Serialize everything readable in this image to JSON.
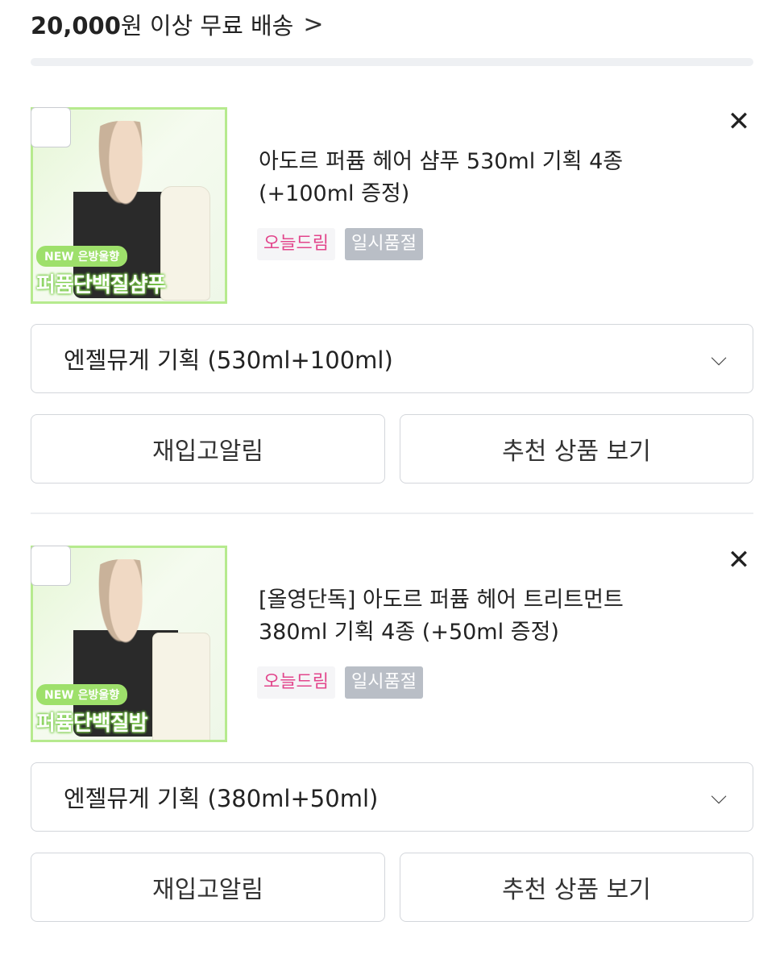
{
  "shipping": {
    "amount": "20,000",
    "text": "원 이상 무료 배송",
    "chevron": ">"
  },
  "items": [
    {
      "title_line1": "아도르 퍼퓸 헤어 샴푸 530ml 기획 4종",
      "title_line2": "(+100ml 증정)",
      "badge_today": "오늘드림",
      "badge_soldout": "일시품절",
      "thumb_new": "NEW 은방울향",
      "thumb_big": "퍼퓸단백질샴푸",
      "option": "엔젤뮤게 기획 (530ml+100ml)",
      "restock_label": "재입고알림",
      "recommend_label": "추천 상품 보기"
    },
    {
      "title_line1": "[올영단독] 아도르 퍼퓸 헤어 트리트먼트",
      "title_line2": "380ml 기획 4종 (+50ml 증정)",
      "badge_today": "오늘드림",
      "badge_soldout": "일시품절",
      "thumb_new": "NEW 은방울향",
      "thumb_big": "퍼퓸단백질밤",
      "option": "엔젤뮤게 기획 (380ml+50ml)",
      "restock_label": "재입고알림",
      "recommend_label": "추천 상품 보기"
    }
  ],
  "icons": {
    "close": "✕",
    "dropdown": "⌵"
  },
  "colors": {
    "badge_today_text": "#e2468c",
    "badge_soldout_bg": "#b9bec6",
    "thumb_border": "#b6ea8e"
  }
}
